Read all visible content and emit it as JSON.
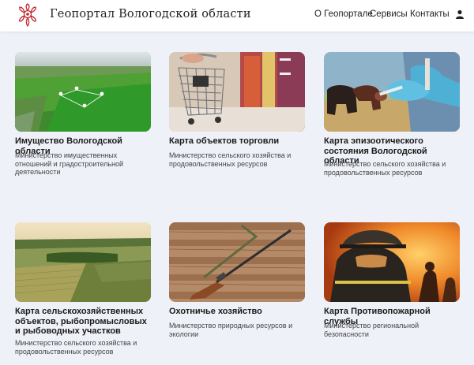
{
  "header": {
    "brand": "Геопортал Вологодской области",
    "nav": [
      "О Геопортале",
      "Сервисы",
      "Контакты"
    ]
  },
  "cards": [
    {
      "title": "Имущество Вологодской области",
      "desc": "Министерство имущественных отношений и градостроительной деятельности",
      "image": "aerial-field-image"
    },
    {
      "title": "Карта объектов торговли",
      "desc": "Министерство сельского хозяйства и продовольственных ресурсов",
      "image": "shopping-cart-image"
    },
    {
      "title": "Карта эпизоотического состояния Вологодской области",
      "desc": "Министерство сельского хозяйства и продовольственных ресурсов",
      "image": "veterinary-cow-image"
    },
    {
      "title": "Карта сельскохозяйственных объектов, рыбопромысловых и рыбоводных участков",
      "desc": "Министерство сельского хозяйства и продовольственных ресурсов",
      "image": "farmland-image"
    },
    {
      "title": "Охотничье хозяйство",
      "desc": "Министерство природных ресурсов и экологии",
      "image": "hunting-rifle-image"
    },
    {
      "title": "Карта Противопожарной службы",
      "desc": "Министерство региональной безопасности",
      "image": "firefighter-image"
    }
  ],
  "colors": {
    "accent": "#c0262d",
    "background": "#eef1f8",
    "header": "#ffffff"
  },
  "icons": {
    "logo": "logo-icon",
    "user": "user-icon"
  }
}
